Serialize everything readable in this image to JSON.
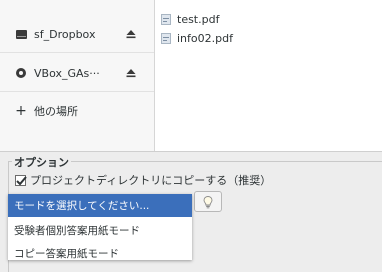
{
  "sidebar": {
    "places": [
      {
        "label": "sf_Dropbox",
        "icon": "drive-icon",
        "eject": true
      },
      {
        "label": "VBox_GAs···",
        "icon": "disc-icon",
        "eject": true
      },
      {
        "label": "他の場所",
        "icon": "plus-icon",
        "eject": false
      }
    ]
  },
  "files": [
    {
      "name": "test.pdf",
      "icon": "document-icon"
    },
    {
      "name": "info02.pdf",
      "icon": "document-icon"
    }
  ],
  "options": {
    "title": "オプション",
    "copy_checkbox_label": "プロジェクトディレクトリにコピーする（推奨）",
    "copy_checked": true,
    "hint_button_icon": "lightbulb-icon"
  },
  "mode_dropdown": {
    "items": [
      "モードを選択してください...",
      "受験者個別答案用紙モード",
      "コピー答案用紙モード"
    ],
    "selected_index": 0
  },
  "colors": {
    "selection": "#3b6fbb",
    "window_bg": "#ededed"
  }
}
